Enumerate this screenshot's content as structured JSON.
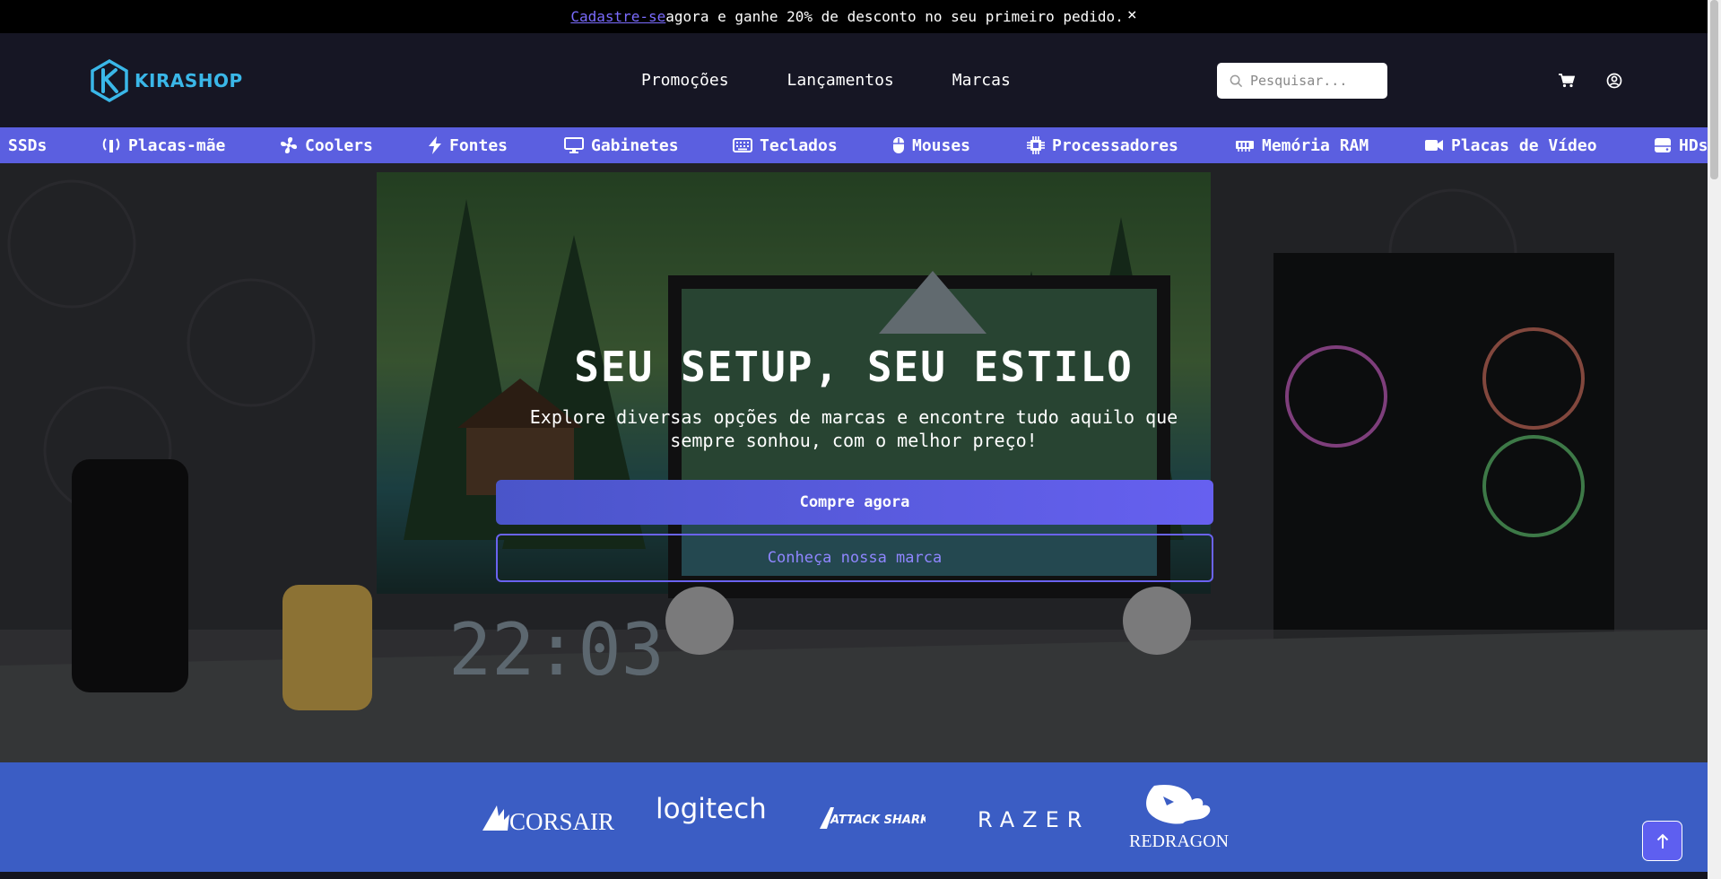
{
  "announcement": {
    "link_text": "Cadastre-se",
    "text": " agora e ganhe 20% de desconto no seu primeiro pedido.",
    "close_icon": "close-icon"
  },
  "header": {
    "logo_text": "KIRASHOP",
    "nav": [
      "Promoções",
      "Lançamentos",
      "Marcas"
    ],
    "search_placeholder": "Pesquisar...",
    "icons": [
      "search-icon",
      "cart-icon",
      "user-icon"
    ]
  },
  "categories": [
    {
      "label": "SSDs",
      "icon": "ssd-icon"
    },
    {
      "label": "Placas-mãe",
      "icon": "motherboard-icon"
    },
    {
      "label": "Coolers",
      "icon": "fan-icon"
    },
    {
      "label": "Fontes",
      "icon": "bolt-icon"
    },
    {
      "label": "Gabinetes",
      "icon": "monitor-icon"
    },
    {
      "label": "Teclados",
      "icon": "keyboard-icon"
    },
    {
      "label": "Mouses",
      "icon": "mouse-icon"
    },
    {
      "label": "Processadores",
      "icon": "cpu-icon"
    },
    {
      "label": "Memória RAM",
      "icon": "memory-icon"
    },
    {
      "label": "Placas de Vídeo",
      "icon": "video-icon"
    },
    {
      "label": "HDs",
      "icon": "hdd-icon"
    }
  ],
  "hero": {
    "title": "SEU SETUP, SEU ESTILO",
    "subtitle": "Explore diversas opções de marcas e encontre tudo aquilo que sempre sonhou, com o melhor preço!",
    "primary_button": "Compre agora",
    "secondary_button": "Conheça nossa marca"
  },
  "brands": [
    "CORSAIR",
    "logitech",
    "ATTACK SHARK",
    "RAZER",
    "REDRAGON"
  ],
  "colors": {
    "accent": "#5b5fe0",
    "brands_bg": "#3b5dc4",
    "logo": "#3ab7e8",
    "header_bg": "#161624"
  }
}
